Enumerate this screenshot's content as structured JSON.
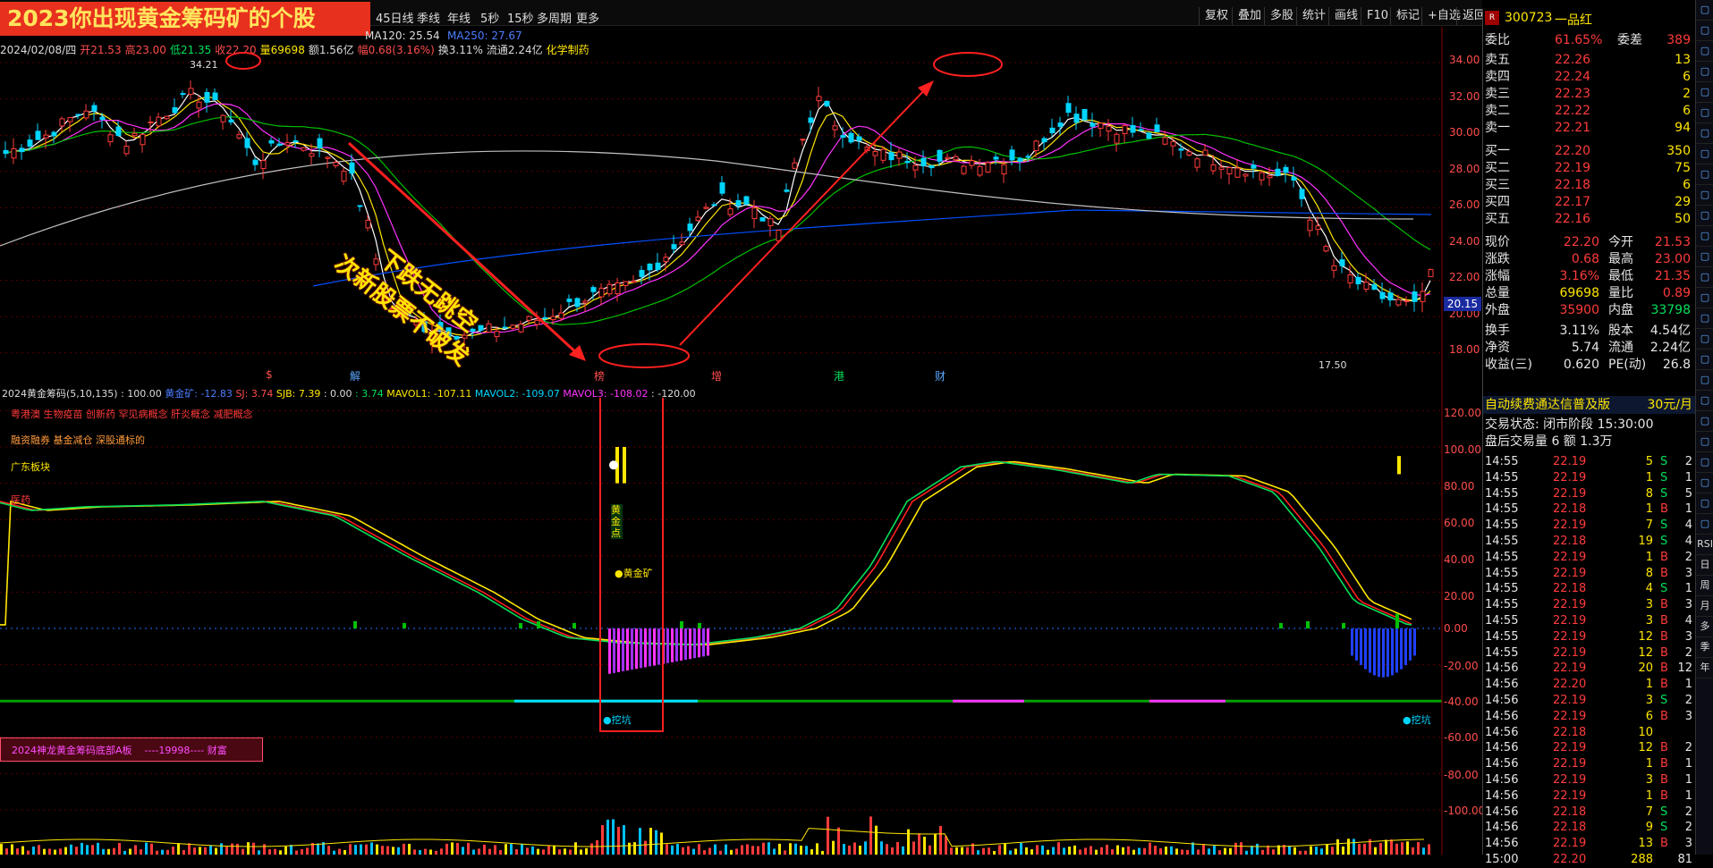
{
  "banner": "2023你出现黄金筹码矿的个股",
  "periods": [
    "45日线",
    "季线",
    "年线",
    "5秒",
    "15秒",
    "多周期",
    "更多"
  ],
  "toolbar": [
    "复权",
    "叠加",
    "多股",
    "统计",
    "画线",
    "F10",
    "标记",
    "+自选",
    "返回"
  ],
  "info": {
    "date": "2024/02/08/四",
    "open": "开21.53",
    "high": "高23.00",
    "low": "低21.35",
    "close": "收22.20",
    "volume": "量69698",
    "amount": "额1.56亿",
    "change": "幅0.68(3.16%)",
    "turnover": "换3.11%",
    "float": "流通2.24亿",
    "industry": "化学制药",
    "ma120": "MA120: 25.54",
    "ma250": "MA250: 27.67"
  },
  "price_axis": [
    "34.00",
    "32.00",
    "30.00",
    "28.00",
    "26.00",
    "24.00",
    "22.00",
    "20.00",
    "18.00"
  ],
  "current_price_tag": "20.15",
  "high_marker": "34.21",
  "low_marker": "17.50",
  "annotations": {
    "line1": "下跌无跳空",
    "line2": "次新股票不破发"
  },
  "event_markers": [
    "$",
    "解",
    "榜",
    "增",
    "港",
    "财"
  ],
  "indicator": {
    "header_name": "2024黄金筹码(5,10,135)",
    "header_value": ": 100.00",
    "gold_mine": "黄金矿: -12.83",
    "sj": "SJ: 3.74",
    "sjb": "SJB: 7.39",
    "zero": ": 0.00",
    "val": ": 3.74",
    "mavol1": "MAVOL1: -107.11",
    "mavol2": "MAVOL2: -109.07",
    "mavol3": "MAVOL3: -108.02",
    "last": ": -120.00",
    "concepts1": "粤港澳 生物疫苗 创新药 罕见病概念 肝炎概念 减肥概念",
    "concepts2": "融资融券 基金减仓 深股通标的",
    "region": "广东板块",
    "label_top": "医药",
    "label_gold_vert": "黄金点",
    "label_gold_mine": "●黄金矿",
    "label_pit_left": "●挖坑",
    "label_pit_right": "●挖坑",
    "footer_box": "2024神龙黄金筹码底部A板    ----19998---- 财富",
    "y_axis": [
      "120.00",
      "100.00",
      "80.00",
      "60.00",
      "40.00",
      "20.00",
      "0.00",
      "-20.00",
      "-40.00",
      "-60.00",
      "-80.00",
      "-100.00"
    ]
  },
  "stock": {
    "code": "300723",
    "name": "一品红"
  },
  "orderbook": {
    "weibi_label": "委比",
    "weibi": "61.65%",
    "weicha_label": "委差",
    "weicha": "389",
    "asks": [
      {
        "label": "卖五",
        "price": "22.26",
        "vol": "13"
      },
      {
        "label": "卖四",
        "price": "22.24",
        "vol": "6"
      },
      {
        "label": "卖三",
        "price": "22.23",
        "vol": "2"
      },
      {
        "label": "卖二",
        "price": "22.22",
        "vol": "6"
      },
      {
        "label": "卖一",
        "price": "22.21",
        "vol": "94"
      }
    ],
    "bids": [
      {
        "label": "买一",
        "price": "22.20",
        "vol": "350"
      },
      {
        "label": "买二",
        "price": "22.19",
        "vol": "75"
      },
      {
        "label": "买三",
        "price": "22.18",
        "vol": "6"
      },
      {
        "label": "买四",
        "price": "22.17",
        "vol": "29"
      },
      {
        "label": "买五",
        "price": "22.16",
        "vol": "50"
      }
    ]
  },
  "quote": [
    {
      "l1": "现价",
      "v1": "22.20",
      "l2": "今开",
      "v2": "21.53"
    },
    {
      "l1": "涨跌",
      "v1": "0.68",
      "l2": "最高",
      "v2": "23.00"
    },
    {
      "l1": "涨幅",
      "v1": "3.16%",
      "l2": "最低",
      "v2": "21.35"
    },
    {
      "l1": "总量",
      "v1": "69698",
      "l2": "量比",
      "v2": "0.89"
    },
    {
      "l1": "外盘",
      "v1": "35900",
      "l2": "内盘",
      "v2": "33798"
    },
    {
      "l1": "换手",
      "v1": "3.11%",
      "l2": "股本",
      "v2": "4.54亿"
    },
    {
      "l1": "净资",
      "v1": "5.74",
      "l2": "流通",
      "v2": "2.24亿"
    },
    {
      "l1": "收益(三)",
      "v1": "0.620",
      "l2": "PE(动)",
      "v2": "26.8"
    }
  ],
  "promo": "自动续费通达信普及版",
  "promo_price": "30元/月",
  "status": {
    "line1": "交易状态: 闭市阶段 15:30:00",
    "line2": "盘后交易量 6 额 1.3万"
  },
  "trades": [
    [
      "14:55",
      "22.19",
      "5",
      "S",
      "2"
    ],
    [
      "14:55",
      "22.19",
      "1",
      "S",
      "1"
    ],
    [
      "14:55",
      "22.19",
      "8",
      "S",
      "5"
    ],
    [
      "14:55",
      "22.18",
      "1",
      "B",
      "1"
    ],
    [
      "14:55",
      "22.19",
      "7",
      "S",
      "4"
    ],
    [
      "14:55",
      "22.18",
      "19",
      "S",
      "4"
    ],
    [
      "14:55",
      "22.19",
      "1",
      "B",
      "2"
    ],
    [
      "14:55",
      "22.19",
      "8",
      "B",
      "3"
    ],
    [
      "14:55",
      "22.18",
      "4",
      "S",
      "1"
    ],
    [
      "14:55",
      "22.19",
      "3",
      "B",
      "3"
    ],
    [
      "14:55",
      "22.19",
      "3",
      "B",
      "4"
    ],
    [
      "14:55",
      "22.19",
      "12",
      "B",
      "3"
    ],
    [
      "14:55",
      "22.19",
      "12",
      "B",
      "2"
    ],
    [
      "14:56",
      "22.19",
      "20",
      "B",
      "12"
    ],
    [
      "14:56",
      "22.20",
      "1",
      "B",
      "1"
    ],
    [
      "14:56",
      "22.19",
      "3",
      "S",
      "2"
    ],
    [
      "14:56",
      "22.19",
      "6",
      "B",
      "3"
    ],
    [
      "14:56",
      "22.18",
      "10",
      "",
      ""
    ],
    [
      "14:56",
      "22.19",
      "12",
      "B",
      "2"
    ],
    [
      "14:56",
      "22.19",
      "1",
      "B",
      "1"
    ],
    [
      "14:56",
      "22.19",
      "3",
      "B",
      "1"
    ],
    [
      "14:56",
      "22.19",
      "1",
      "B",
      "1"
    ],
    [
      "14:56",
      "22.18",
      "7",
      "S",
      "2"
    ],
    [
      "14:56",
      "22.18",
      "9",
      "S",
      "2"
    ],
    [
      "14:56",
      "22.19",
      "13",
      "B",
      "3"
    ],
    [
      "15:00",
      "22.20",
      "288",
      "",
      "81"
    ]
  ],
  "side_icons": [
    "RSI",
    "日",
    "周",
    "月",
    "多",
    "季",
    "年"
  ],
  "colors": {
    "up": "#ff3b3b",
    "down": "#00d5ff",
    "ma5": "#ffffff",
    "ma10": "#ffe600",
    "ma20": "#ff33ff",
    "ma60": "#00c000",
    "ma120": "#0050ff",
    "ma250": "#c0c0c0"
  }
}
